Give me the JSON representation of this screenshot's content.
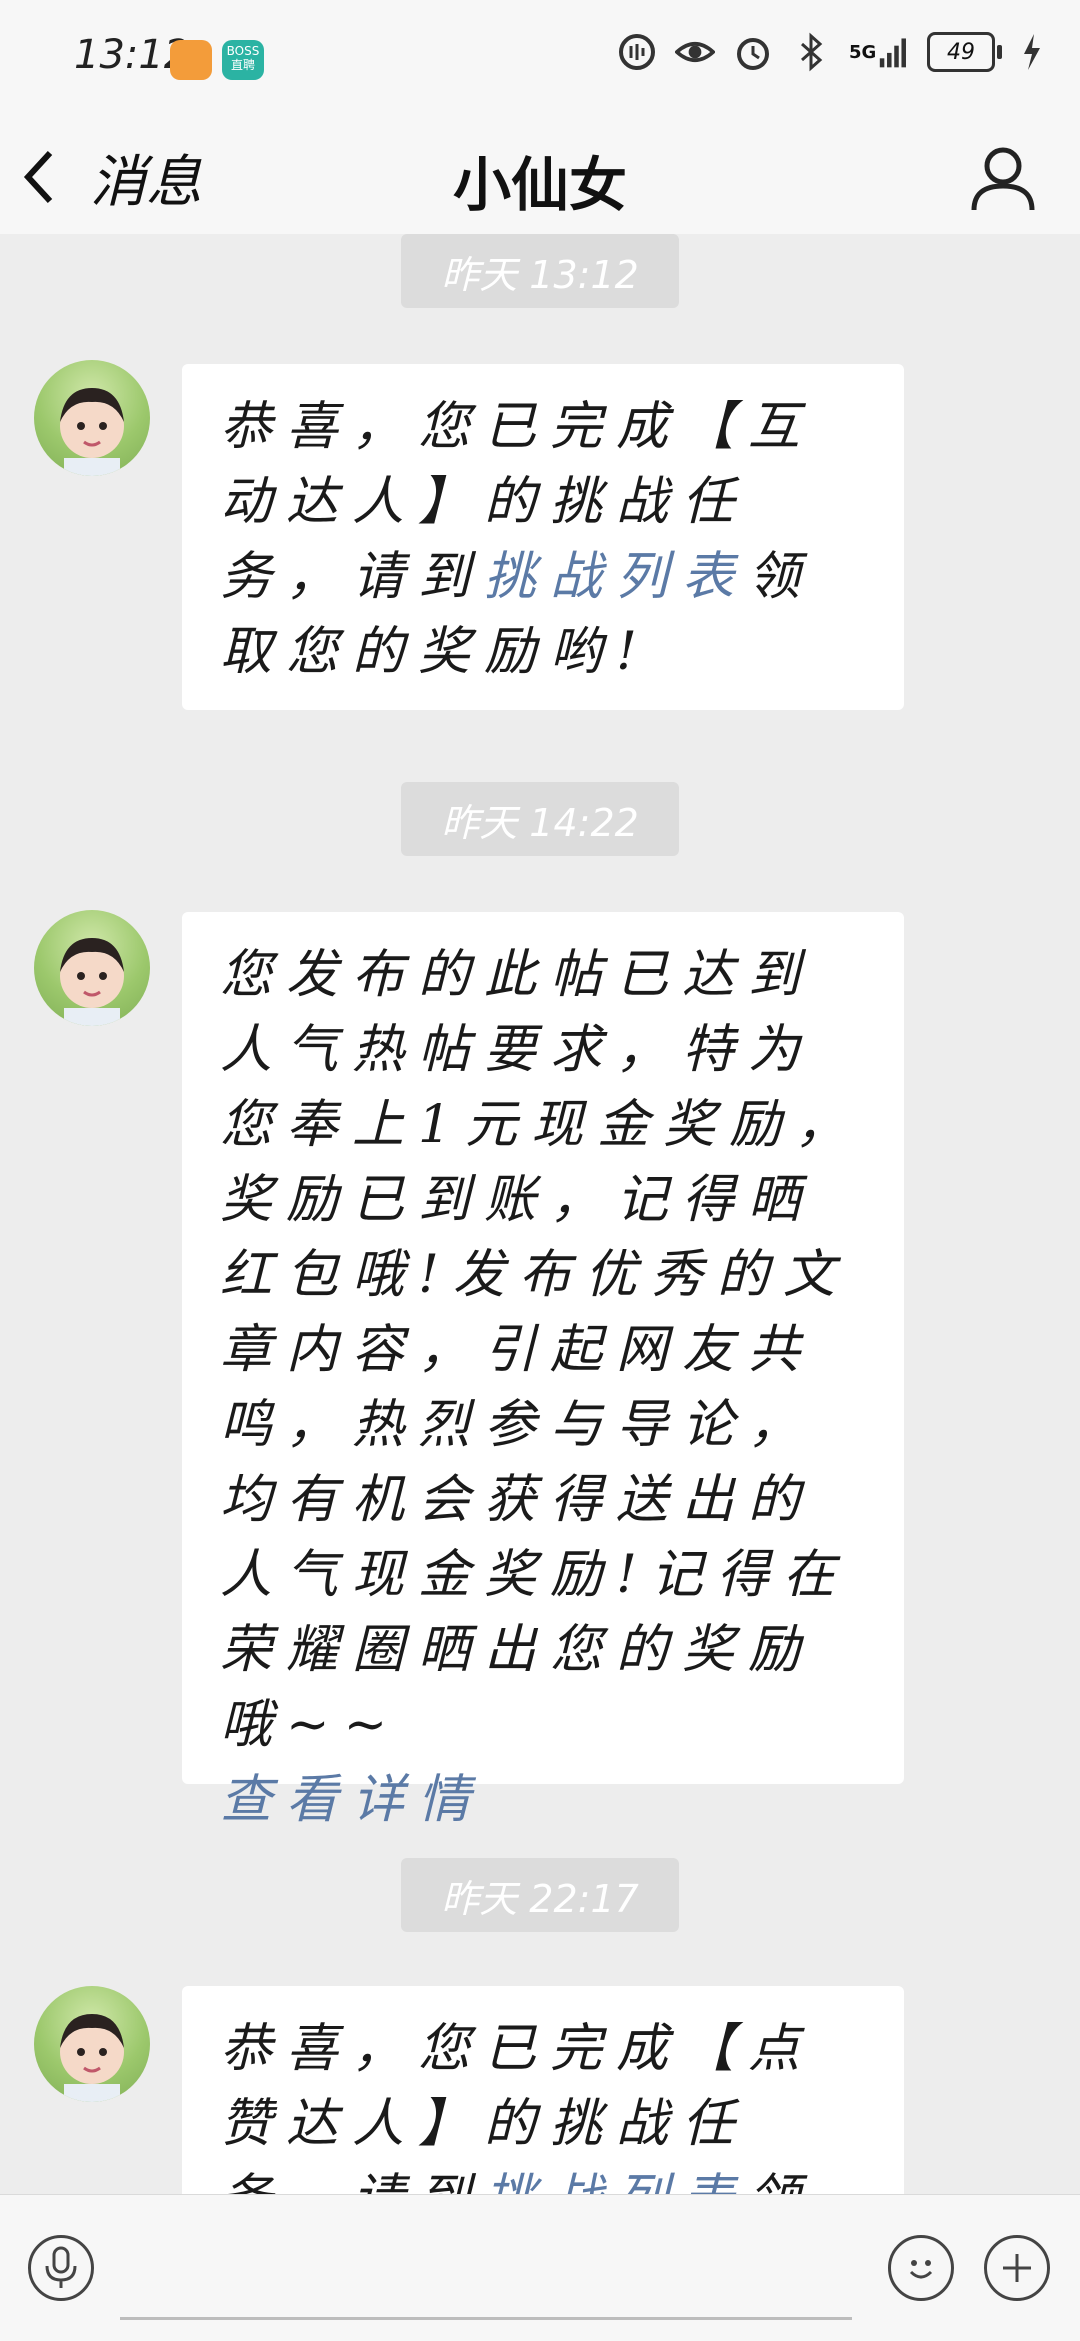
{
  "status_bar": {
    "time": "13:12",
    "app_badge_2": "BOSS直聘",
    "network": "5G",
    "battery": "49"
  },
  "header": {
    "back_label": "消息",
    "title": "小仙女"
  },
  "messages": [
    {
      "timestamp": "昨天 13:12",
      "text_before": "恭喜，您已完成【互动达人】的挑战任务，请到",
      "link": "挑战列表",
      "text_after": "领取您的奖励哟!"
    },
    {
      "timestamp": "昨天 14:22",
      "text": "您发布的此帖已达到人气热帖要求，特为您奉上1元现金奖励，奖励已到账，记得晒红包哦!发布优秀的文章内容，引起网友共鸣，热烈参与导论，均有机会获得送出的人气现金奖励!记得在荣耀圈晒出您的奖励哦~~",
      "link": "查看详情"
    },
    {
      "timestamp": "昨天 22:17",
      "text_before": "恭喜，您已完成【点赞达人】的挑战任务，请到",
      "link": "挑战列表",
      "text_after": "领取您的奖"
    }
  ],
  "colors": {
    "background": "#ededed",
    "bubble": "#ffffff",
    "link": "#5b7aa6",
    "timestamp_bg": "#dcdcdc"
  },
  "icons": [
    "back-chevron-icon",
    "profile-icon",
    "microphone-icon",
    "emoji-icon",
    "plus-icon"
  ]
}
